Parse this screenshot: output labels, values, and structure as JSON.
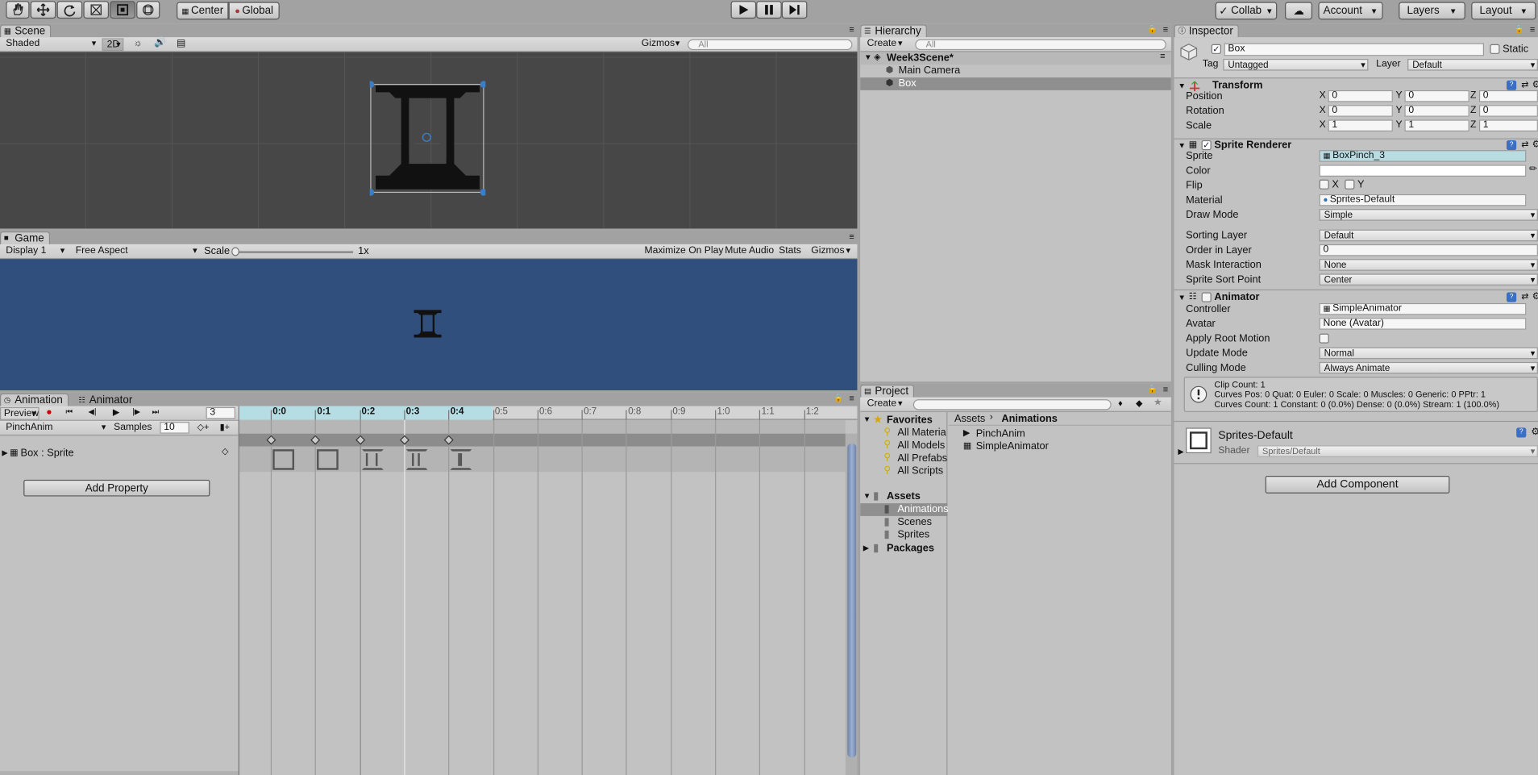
{
  "toolbar": {
    "pivot": "Center",
    "space": "Global",
    "collab": "Collab",
    "account": "Account",
    "layers": "Layers",
    "layout": "Layout"
  },
  "scene": {
    "tab": "Scene",
    "shading": "Shaded",
    "mode2d": "2D",
    "gizmos": "Gizmos",
    "search_placeholder": "All"
  },
  "game": {
    "tab": "Game",
    "display": "Display 1",
    "aspect": "Free Aspect",
    "scale_label": "Scale",
    "scale_value": "1x",
    "maximize": "Maximize On Play",
    "mute": "Mute Audio",
    "stats": "Stats",
    "gizmos": "Gizmos",
    "bg_color": "#314f7c"
  },
  "animation": {
    "tab": "Animation",
    "tab2": "Animator",
    "preview": "Preview",
    "frame": "3",
    "clip": "PinchAnim",
    "samples_label": "Samples",
    "samples": "10",
    "property": "Box : Sprite",
    "add_property": "Add Property",
    "ticks": [
      "0:0",
      "0:1",
      "0:2",
      "0:3",
      "0:4",
      "0:5",
      "0:6",
      "0:7",
      "0:8",
      "0:9",
      "1:0",
      "1:1",
      "1:2"
    ]
  },
  "hierarchy": {
    "tab": "Hierarchy",
    "create": "Create",
    "search_placeholder": "All",
    "scene": "Week3Scene*",
    "items": [
      "Main Camera",
      "Box"
    ]
  },
  "project": {
    "tab": "Project",
    "create": "Create",
    "favorites": "Favorites",
    "fav_items": [
      "All Materia",
      "All Models",
      "All Prefabs",
      "All Scripts"
    ],
    "assets": "Assets",
    "asset_items": [
      "Animations",
      "Scenes",
      "Sprites"
    ],
    "packages": "Packages",
    "breadcrumb": [
      "Assets",
      "Animations"
    ],
    "files": [
      "PinchAnim",
      "SimpleAnimator"
    ]
  },
  "inspector": {
    "tab": "Inspector",
    "name": "Box",
    "static": "Static",
    "tag_label": "Tag",
    "tag": "Untagged",
    "layer_label": "Layer",
    "layer": "Default",
    "transform": {
      "title": "Transform",
      "position": "Position",
      "rotation": "Rotation",
      "scale": "Scale",
      "pos": [
        "0",
        "0",
        "0"
      ],
      "rot": [
        "0",
        "0",
        "0"
      ],
      "scl": [
        "1",
        "1",
        "1"
      ]
    },
    "sprite_renderer": {
      "title": "Sprite Renderer",
      "sprite_label": "Sprite",
      "sprite": "BoxPinch_3",
      "color_label": "Color",
      "flip_label": "Flip",
      "flip_x": "X",
      "flip_y": "Y",
      "material_label": "Material",
      "material": "Sprites-Default",
      "drawmode_label": "Draw Mode",
      "drawmode": "Simple",
      "sortinglayer_label": "Sorting Layer",
      "sortinglayer": "Default",
      "order_label": "Order in Layer",
      "order": "0",
      "mask_label": "Mask Interaction",
      "mask": "None",
      "sortpoint_label": "Sprite Sort Point",
      "sortpoint": "Center"
    },
    "animator": {
      "title": "Animator",
      "controller_label": "Controller",
      "controller": "SimpleAnimator",
      "avatar_label": "Avatar",
      "avatar": "None (Avatar)",
      "rootmotion_label": "Apply Root Motion",
      "update_label": "Update Mode",
      "update": "Normal",
      "culling_label": "Culling Mode",
      "culling": "Always Animate",
      "info1": "Clip Count: 1",
      "info2": "Curves Pos: 0 Quat: 0 Euler: 0 Scale: 0 Muscles: 0 Generic: 0 PPtr: 1",
      "info3": "Curves Count: 1 Constant: 0 (0.0%) Dense: 0 (0.0%) Stream: 1 (100.0%)"
    },
    "material": {
      "name": "Sprites-Default",
      "shader_label": "Shader",
      "shader": "Sprites/Default"
    },
    "add_component": "Add Component"
  }
}
